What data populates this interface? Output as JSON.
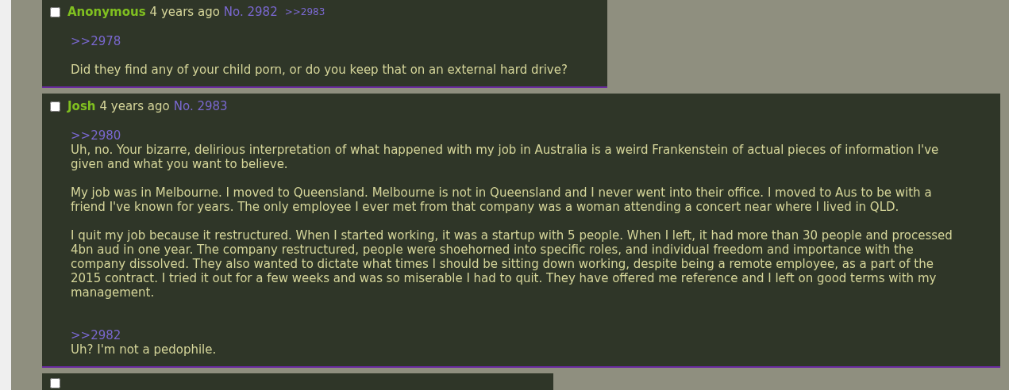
{
  "posts": [
    {
      "checked": false,
      "name": "Anonymous",
      "time": "4 years ago",
      "number": "No. 2982",
      "replies": [
        ">>2983"
      ],
      "body": [
        {
          "kind": "break"
        },
        {
          "kind": "quote",
          "text": ">>2978"
        },
        {
          "kind": "break"
        },
        {
          "kind": "text",
          "text": "Did they find any of your child porn, or do you keep that on an external hard drive?"
        }
      ]
    },
    {
      "checked": false,
      "name": "Josh",
      "time": "4 years ago",
      "number": "No. 2983",
      "body": [
        {
          "kind": "break"
        },
        {
          "kind": "quote",
          "text": ">>2980"
        },
        {
          "kind": "text",
          "text": "Uh, no. Your bizarre, delirious interpretation of what happened with my job in Australia is a weird Frankenstein of actual pieces of information I've given and what you want to believe."
        },
        {
          "kind": "break"
        },
        {
          "kind": "text",
          "text": "My job was in Melbourne. I moved to Queensland. Melbourne is not in Queensland and I never went into their office. I moved to Aus to be with a friend I've known for years. The only employee I ever met from that company was a woman attending a concert near where I lived in QLD."
        },
        {
          "kind": "break"
        },
        {
          "kind": "text",
          "text": "I quit my job because it restructured. When I started working, it was a startup with 5 people. When I left, it had more than 30 people and processed 4bn aud in one year. The company restructured, people were shoehorned into specific roles, and individual freedom and importance with the company dissolved. They also wanted to dictate what times I should be sitting down working, despite being a remote employee, as a part of the 2015 contract. I tried it out for a few weeks and was so miserable I had to quit. They have offered me reference and I left on good terms with my management."
        },
        {
          "kind": "break"
        },
        {
          "kind": "break"
        },
        {
          "kind": "quote",
          "text": ">>2982"
        },
        {
          "kind": "text",
          "text": "Uh? I'm not a pedophile."
        }
      ]
    },
    {
      "checked": false
    }
  ]
}
